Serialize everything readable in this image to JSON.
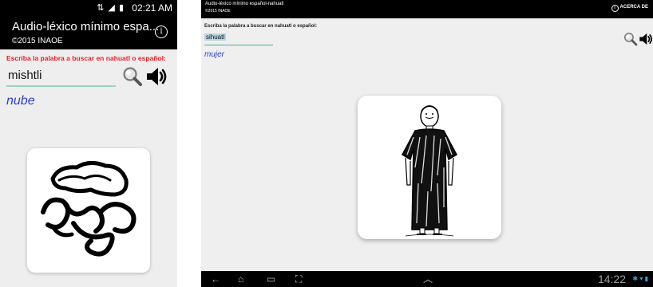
{
  "phone": {
    "status_time": "02:21 AM",
    "status_icons": "⇅ ◢ ▮",
    "title": "Audio-léxico mínimo espa...",
    "subtitle": "©2015 INAOE",
    "info_glyph": "i",
    "prompt": "Escriba la palabra a buscar en nahuatl o español:",
    "input_value": "mishtli",
    "result": "nube"
  },
  "tablet": {
    "title": "Audio-léxico mínimo español-nahuatl",
    "subtitle": "©2015 INAOE",
    "about_glyph": "i",
    "about_label": "ACERCA DE",
    "prompt": "Escriba la palabra a buscar en nahuatl o español:",
    "input_value": "sihuatl",
    "result": "mujer",
    "clock": "14:22",
    "tray": "✱ ▾ ▮"
  },
  "colors": {
    "prompt_red": "#e8202a",
    "result_blue": "#2b3ec7",
    "underline_green": "#9ad4be"
  },
  "icons": [
    "search-icon",
    "speaker-icon",
    "info-icon",
    "back-icon",
    "home-icon",
    "recents-icon",
    "screenshot-icon",
    "chevron-up-icon"
  ]
}
